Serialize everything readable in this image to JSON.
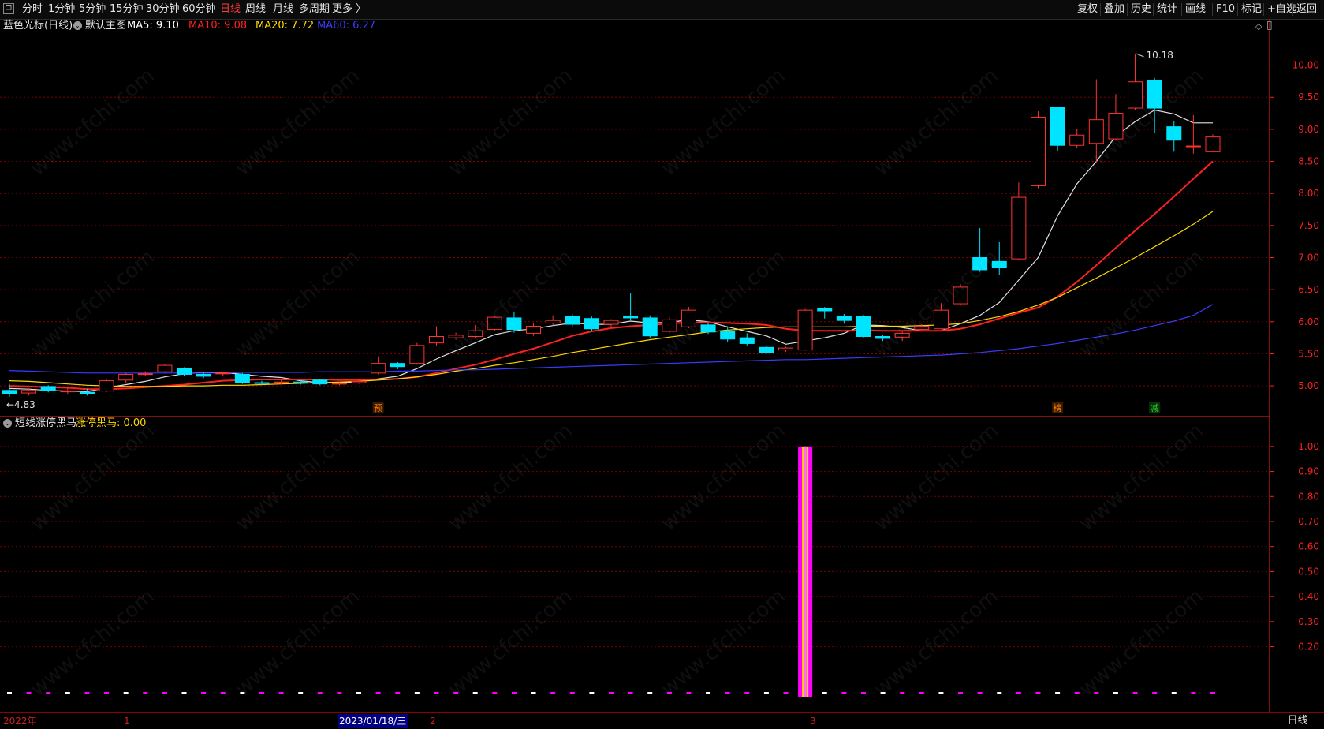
{
  "toolbar": {
    "icon": "window-restore-icon",
    "periods": [
      "分时",
      "1分钟",
      "5分钟",
      "15分钟",
      "30分钟",
      "60分钟",
      "日线",
      "周线",
      "月线",
      "多周期",
      "更多 〉"
    ],
    "active_period": "日线",
    "right_buttons": [
      "复权",
      "叠加",
      "历史",
      "统计",
      "画线",
      "F10",
      "标记",
      "+自选",
      "返回"
    ]
  },
  "main_panel": {
    "cursor_name": "蓝色光标(日线)",
    "indicator_name": "默认主图",
    "ma": [
      {
        "label": "MA5: 9.10",
        "color": "#ffffff"
      },
      {
        "label": "MA10: 9.08",
        "color": "#ff2020"
      },
      {
        "label": "MA20: 7.72",
        "color": "#ffd700"
      },
      {
        "label": "MA60: 6.27",
        "color": "#3a3aff"
      }
    ],
    "high_marker": "10.18",
    "low_marker": "←4.83",
    "markers": [
      {
        "text": "预",
        "color": "#ff8000",
        "bg": "#3a1a00"
      },
      {
        "text": "榜",
        "color": "#ff8000",
        "bg": "#3a1a00"
      },
      {
        "text": "减",
        "color": "#33cc33",
        "bg": "#063306"
      }
    ]
  },
  "sub_panel": {
    "indicator_name": "短线涨停黑马",
    "value_label": "涨停黑马: 0.00",
    "value_color": "#ffd700"
  },
  "date_bar": {
    "labels": [
      "2022年",
      "1",
      "2023/01/18/三",
      "2",
      "3"
    ],
    "period_label": "日线"
  },
  "watermark": "www.cfchi.com",
  "colors": {
    "up": "#ff3232",
    "down": "#00e5ff",
    "axis": "#ff2020",
    "grid": "#7a0000",
    "bar": "#ff00ff"
  },
  "chart_data": [
    {
      "type": "candlestick",
      "title": "蓝色光标(日线)",
      "ylim": [
        4.62,
        10.45
      ],
      "yticks": [
        5.0,
        5.5,
        6.0,
        6.5,
        7.0,
        7.5,
        8.0,
        8.5,
        9.0,
        9.5,
        10.0
      ],
      "ytick_labels": [
        "5.00",
        "5.50",
        "6.00",
        "6.50",
        "7.00",
        "7.50",
        "8.00",
        "8.50",
        "9.00",
        "9.50",
        "10.00"
      ],
      "grid": true,
      "candles": [
        [
          4.93,
          4.88,
          5.03,
          4.83
        ],
        [
          4.89,
          4.93,
          4.97,
          4.85
        ],
        [
          4.99,
          4.93,
          5.01,
          4.9
        ],
        [
          4.91,
          4.92,
          4.99,
          4.87
        ],
        [
          4.9,
          4.88,
          4.96,
          4.85
        ],
        [
          4.92,
          5.08,
          5.1,
          4.9
        ],
        [
          5.09,
          5.18,
          5.2,
          5.05
        ],
        [
          5.18,
          5.19,
          5.23,
          5.15
        ],
        [
          5.22,
          5.32,
          5.34,
          5.2
        ],
        [
          5.27,
          5.18,
          5.29,
          5.16
        ],
        [
          5.18,
          5.15,
          5.21,
          5.12
        ],
        [
          5.19,
          5.2,
          5.22,
          5.15
        ],
        [
          5.18,
          5.05,
          5.2,
          5.03
        ],
        [
          5.05,
          5.04,
          5.08,
          5.01
        ],
        [
          5.05,
          5.06,
          5.09,
          5.02
        ],
        [
          5.06,
          5.05,
          5.09,
          5.02
        ],
        [
          5.09,
          5.03,
          5.11,
          5.01
        ],
        [
          5.03,
          5.04,
          5.06,
          5.01
        ],
        [
          5.05,
          5.07,
          5.09,
          5.03
        ],
        [
          5.2,
          5.35,
          5.46,
          5.18
        ],
        [
          5.35,
          5.3,
          5.37,
          5.26
        ],
        [
          5.35,
          5.63,
          5.67,
          5.33
        ],
        [
          5.67,
          5.77,
          5.93,
          5.62
        ],
        [
          5.75,
          5.79,
          5.83,
          5.72
        ],
        [
          5.77,
          5.86,
          5.95,
          5.74
        ],
        [
          5.88,
          6.07,
          6.09,
          5.85
        ],
        [
          6.06,
          5.88,
          6.16,
          5.83
        ],
        [
          5.82,
          5.93,
          5.98,
          5.78
        ],
        [
          5.98,
          6.02,
          6.1,
          5.94
        ],
        [
          6.08,
          5.96,
          6.12,
          5.92
        ],
        [
          6.05,
          5.89,
          6.08,
          5.86
        ],
        [
          5.96,
          6.02,
          6.04,
          5.92
        ],
        [
          6.09,
          6.06,
          6.44,
          6.03
        ],
        [
          6.06,
          5.78,
          6.1,
          5.74
        ],
        [
          5.85,
          6.03,
          6.07,
          5.82
        ],
        [
          5.92,
          6.18,
          6.23,
          5.9
        ],
        [
          5.95,
          5.84,
          5.98,
          5.81
        ],
        [
          5.85,
          5.73,
          5.92,
          5.68
        ],
        [
          5.75,
          5.66,
          5.82,
          5.63
        ],
        [
          5.6,
          5.52,
          5.63,
          5.5
        ],
        [
          5.56,
          5.59,
          5.61,
          5.53
        ],
        [
          5.56,
          6.18,
          6.2,
          5.55
        ],
        [
          6.21,
          6.17,
          6.23,
          6.05
        ],
        [
          6.09,
          6.02,
          6.12,
          5.97
        ],
        [
          6.08,
          5.77,
          6.11,
          5.74
        ],
        [
          5.77,
          5.74,
          5.79,
          5.7
        ],
        [
          5.76,
          5.82,
          5.86,
          5.7
        ],
        [
          5.88,
          5.93,
          5.96,
          5.85
        ],
        [
          5.89,
          6.18,
          6.29,
          5.88
        ],
        [
          6.28,
          6.54,
          6.59,
          6.25
        ],
        [
          7.0,
          6.81,
          7.46,
          6.78
        ],
        [
          6.94,
          6.84,
          7.24,
          6.73
        ],
        [
          6.98,
          7.94,
          8.17,
          6.96
        ],
        [
          8.12,
          9.19,
          9.28,
          8.08
        ],
        [
          9.34,
          8.75,
          9.35,
          8.66
        ],
        [
          8.75,
          8.91,
          9.0,
          8.71
        ],
        [
          8.78,
          9.15,
          9.78,
          8.48
        ],
        [
          8.85,
          9.25,
          9.55,
          8.82
        ],
        [
          9.33,
          9.74,
          10.18,
          9.3
        ],
        [
          9.76,
          9.33,
          9.8,
          8.94
        ],
        [
          9.04,
          8.83,
          9.13,
          8.65
        ],
        [
          8.74,
          8.74,
          9.22,
          8.62
        ],
        [
          8.65,
          8.88,
          8.92,
          8.65
        ]
      ],
      "series": [
        {
          "name": "MA5",
          "color": "#e0e0e0",
          "values": [
            4.96,
            4.95,
            4.93,
            4.92,
            4.91,
            4.97,
            5.02,
            5.07,
            5.14,
            5.19,
            5.21,
            5.21,
            5.18,
            5.15,
            5.13,
            5.08,
            5.05,
            5.05,
            5.06,
            5.11,
            5.15,
            5.27,
            5.42,
            5.55,
            5.67,
            5.8,
            5.86,
            5.89,
            5.94,
            5.98,
            5.96,
            5.96,
            6.01,
            5.98,
            5.99,
            6.03,
            6.0,
            5.92,
            5.85,
            5.78,
            5.65,
            5.7,
            5.75,
            5.82,
            5.95,
            5.94,
            5.91,
            5.86,
            5.86,
            5.97,
            6.1,
            6.3,
            6.65,
            7.0,
            7.65,
            8.15,
            8.5,
            8.89,
            9.12,
            9.3,
            9.24,
            9.1,
            9.1
          ]
        },
        {
          "name": "MA10",
          "color": "#ff2020",
          "values": [
            5.0,
            4.99,
            4.98,
            4.97,
            4.95,
            4.95,
            4.96,
            4.98,
            5.0,
            5.02,
            5.05,
            5.08,
            5.09,
            5.1,
            5.1,
            5.1,
            5.1,
            5.09,
            5.09,
            5.1,
            5.11,
            5.14,
            5.2,
            5.27,
            5.33,
            5.41,
            5.5,
            5.58,
            5.68,
            5.78,
            5.85,
            5.9,
            5.93,
            5.95,
            5.97,
            5.99,
            5.99,
            5.98,
            5.97,
            5.95,
            5.89,
            5.86,
            5.86,
            5.86,
            5.87,
            5.86,
            5.86,
            5.86,
            5.86,
            5.89,
            5.96,
            6.05,
            6.14,
            6.22,
            6.39,
            6.62,
            6.88,
            7.15,
            7.42,
            7.68,
            7.95,
            8.23,
            8.5
          ]
        },
        {
          "name": "MA20",
          "color": "#ffd700",
          "values": [
            5.08,
            5.07,
            5.05,
            5.03,
            5.01,
            5.0,
            4.99,
            4.99,
            4.99,
            5.0,
            5.0,
            5.01,
            5.01,
            5.02,
            5.03,
            5.04,
            5.05,
            5.06,
            5.07,
            5.09,
            5.11,
            5.14,
            5.18,
            5.23,
            5.27,
            5.32,
            5.36,
            5.41,
            5.46,
            5.52,
            5.57,
            5.62,
            5.67,
            5.72,
            5.76,
            5.8,
            5.84,
            5.87,
            5.89,
            5.91,
            5.92,
            5.92,
            5.92,
            5.92,
            5.93,
            5.93,
            5.93,
            5.94,
            5.95,
            5.97,
            6.02,
            6.08,
            6.16,
            6.26,
            6.38,
            6.53,
            6.68,
            6.84,
            7.0,
            7.17,
            7.34,
            7.52,
            7.72
          ]
        },
        {
          "name": "MA60",
          "color": "#3a3aff",
          "values": [
            5.24,
            5.23,
            5.22,
            5.21,
            5.2,
            5.2,
            5.2,
            5.2,
            5.2,
            5.2,
            5.2,
            5.2,
            5.21,
            5.21,
            5.21,
            5.21,
            5.22,
            5.22,
            5.22,
            5.22,
            5.23,
            5.23,
            5.24,
            5.25,
            5.25,
            5.26,
            5.27,
            5.28,
            5.29,
            5.3,
            5.31,
            5.32,
            5.33,
            5.34,
            5.35,
            5.36,
            5.37,
            5.38,
            5.39,
            5.4,
            5.41,
            5.41,
            5.42,
            5.43,
            5.44,
            5.45,
            5.46,
            5.47,
            5.48,
            5.5,
            5.52,
            5.55,
            5.58,
            5.62,
            5.66,
            5.71,
            5.76,
            5.81,
            5.87,
            5.94,
            6.01,
            6.1,
            6.27
          ]
        }
      ]
    },
    {
      "type": "bar",
      "title": "短线涨停黑马",
      "ylim": [
        0,
        1.05
      ],
      "yticks": [
        0.2,
        0.3,
        0.4,
        0.5,
        0.6,
        0.7,
        0.8,
        0.9,
        1.0
      ],
      "ytick_labels": [
        "0.20",
        "0.30",
        "0.40",
        "0.50",
        "0.60",
        "0.70",
        "0.80",
        "0.90",
        "1.00"
      ],
      "grid": true,
      "signal_index": 41,
      "signal_value": 1.0
    }
  ]
}
